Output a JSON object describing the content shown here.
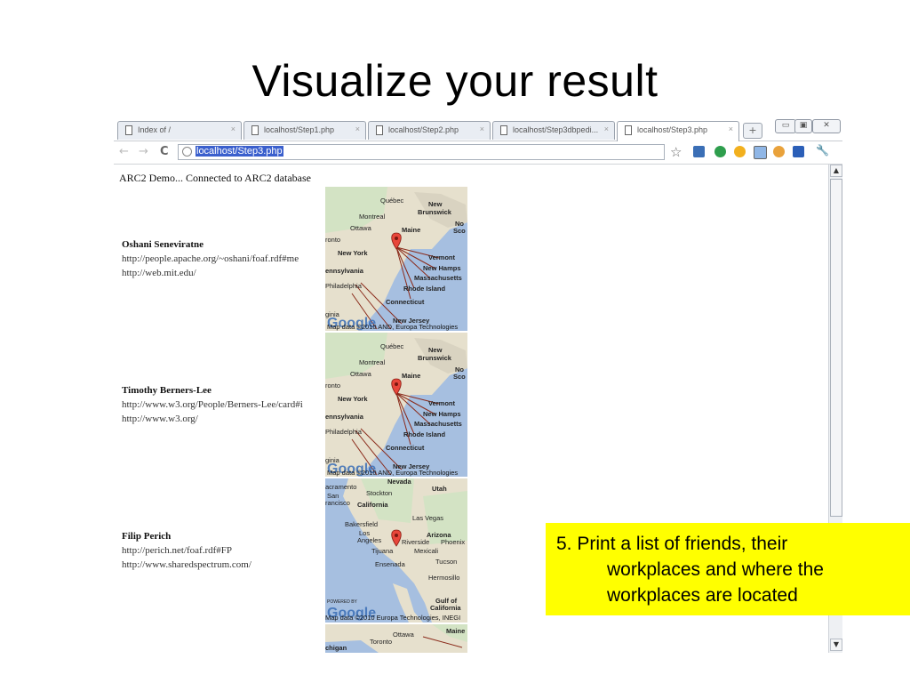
{
  "slide": {
    "title": "Visualize your result"
  },
  "browser": {
    "tabs": [
      {
        "label": "Index of /",
        "active": false
      },
      {
        "label": "localhost/Step1.php",
        "active": false
      },
      {
        "label": "localhost/Step2.php",
        "active": false
      },
      {
        "label": "localhost/Step3dbpedi...",
        "active": false
      },
      {
        "label": "localhost/Step3.php",
        "active": true
      }
    ],
    "tab_close_glyph": "×",
    "newtab_glyph": "+",
    "window_buttons": {
      "minimize": "▭",
      "maximize": "▣",
      "close": "✕"
    },
    "nav": {
      "back": "←",
      "forward": "→",
      "reload": "C"
    },
    "address": "localhost/Step3.php",
    "bookmark_star": "☆",
    "wrench_glyph": "🔧"
  },
  "page": {
    "status": "ARC2 Demo... Connected to ARC2 database",
    "people": [
      {
        "name": "Oshani Seneviratne",
        "foaf": "http://people.apache.org/~oshani/foaf.rdf#me",
        "homepage": "http://web.mit.edu/"
      },
      {
        "name": "Timothy Berners-Lee",
        "foaf": "http://www.w3.org/People/Berners-Lee/card#i",
        "homepage": "http://www.w3.org/"
      },
      {
        "name": "Filip Perich",
        "foaf": "http://perich.net/foaf.rdf#FP",
        "homepage": "http://www.sharedspectrum.com/"
      }
    ],
    "maps": [
      {
        "labels": [
          "Québec",
          "New",
          "Brunswick",
          "Montreal",
          "Ottawa",
          "Maine",
          "No",
          "Sco",
          "ronto",
          "New York",
          "Vermont",
          "New Hamps",
          "ennsylvania",
          "Massachusetts",
          "Philadelphia",
          "Rhode Island",
          "Connecticut",
          "ginia",
          "New Jersey"
        ],
        "attribution": "Map data ©2010 AND, Europa Technologies",
        "logo": "Google"
      },
      {
        "labels": [
          "Québec",
          "New",
          "Brunswick",
          "Montreal",
          "Ottawa",
          "Maine",
          "No",
          "Sco",
          "ronto",
          "New York",
          "Vermont",
          "New Hamps",
          "ennsylvania",
          "Massachusetts",
          "Philadelphia",
          "Rhode Island",
          "Connecticut",
          "ginia",
          "New Jersey"
        ],
        "attribution": "Map data ©2010 AND, Europa Technologies",
        "logo": "Google"
      },
      {
        "labels": [
          "Nevada",
          "Utah",
          "acramento",
          "Stockton",
          "San",
          "rancisco",
          "California",
          "Las Vegas",
          "Bakersfield",
          "Los",
          "Angeles",
          "Arizona",
          "Riverside",
          "Phoenix",
          "Tijuana",
          "Mexicali",
          "Ensenada",
          "Tucson",
          "Hermosillo",
          "Gulf of",
          "California",
          "POWERED BY"
        ],
        "attribution": "Map data ©2010 Europa Technologies, INEGI",
        "logo": "Google"
      },
      {
        "labels": [
          "Maine",
          "Ottawa",
          "Toronto",
          "chigan"
        ]
      }
    ]
  },
  "note": {
    "line1": "5. Print a list of friends, their",
    "line2": "workplaces and where the",
    "line3": "workplaces are located",
    "background": "#ffff00"
  },
  "colors": {
    "selection": "#3a5fcd",
    "map_land": "#e6e0cd",
    "map_water": "#a6bfe0",
    "marker": "#e8463a"
  }
}
